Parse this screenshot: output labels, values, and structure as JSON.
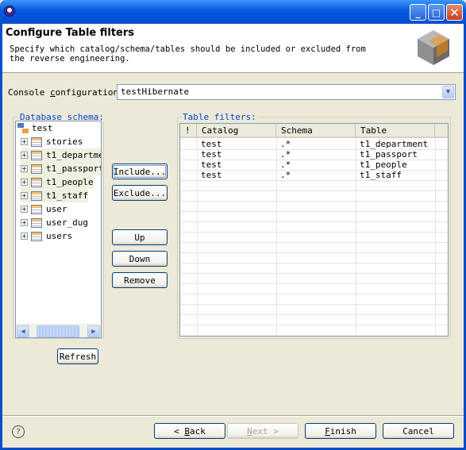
{
  "window": {
    "minimize": "_",
    "maximize": "□",
    "close": "✕"
  },
  "header": {
    "title": "Configure Table filters",
    "description": "Specify which catalog/schema/tables should be included or excluded from the reverse engineering."
  },
  "console": {
    "label_prefix": "Console ",
    "label_underlined": "c",
    "label_suffix": "onfiguration:",
    "value": "testHibernate"
  },
  "schema": {
    "legend": "Database schema:",
    "root": "test",
    "items": [
      {
        "label": "stories"
      },
      {
        "label": "t1_departme"
      },
      {
        "label": "t1_passport"
      },
      {
        "label": "t1_people"
      },
      {
        "label": "t1_staff"
      },
      {
        "label": "user"
      },
      {
        "label": "user_dug"
      },
      {
        "label": "users"
      }
    ],
    "refresh": "Refresh"
  },
  "actions": {
    "include": "Include...",
    "exclude": "Exclude...",
    "up": "Up",
    "down": "Down",
    "remove": "Remove"
  },
  "filters": {
    "legend": "Table filters:",
    "columns": [
      "!",
      "Catalog",
      "Schema",
      "Table"
    ],
    "rows": [
      {
        "catalog": "test",
        "schema": ".*",
        "table": "t1_department"
      },
      {
        "catalog": "test",
        "schema": ".*",
        "table": "t1_passport"
      },
      {
        "catalog": "test",
        "schema": ".*",
        "table": "t1_people"
      },
      {
        "catalog": "test",
        "schema": ".*",
        "table": "t1_staff"
      }
    ]
  },
  "footer": {
    "help": "?",
    "back_arrow": "<",
    "back_underlined": "B",
    "back_rest": "ack",
    "next_underlined": "N",
    "next_rest": "ext",
    "next_arrow": ">",
    "finish_underlined": "F",
    "finish_rest": "inish",
    "cancel": "Cancel"
  }
}
